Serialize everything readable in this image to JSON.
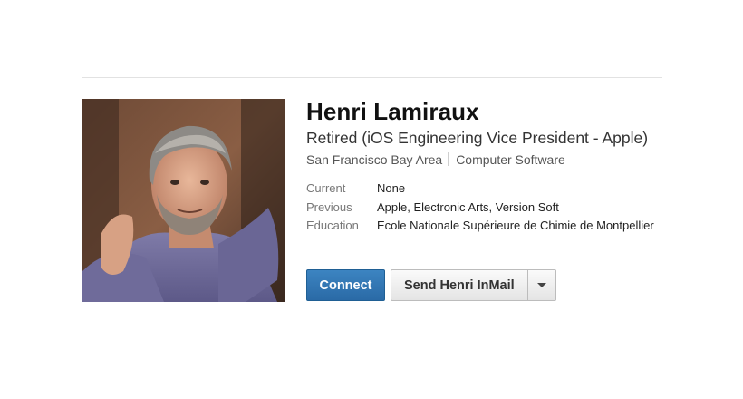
{
  "profile": {
    "name": "Henri Lamiraux",
    "headline": "Retired (iOS Engineering Vice President - Apple)",
    "location": "San Francisco Bay Area",
    "industry": "Computer Software",
    "details": [
      {
        "label": "Current",
        "value": "None"
      },
      {
        "label": "Previous",
        "value": "Apple, Electronic Arts, Version Soft"
      },
      {
        "label": "Education",
        "value": "Ecole Nationale Supérieure de Chimie de Montpellier"
      }
    ]
  },
  "actions": {
    "connect_label": "Connect",
    "inmail_label": "Send Henri InMail",
    "more_icon": "chevron-down-icon"
  },
  "colors": {
    "connect_button": "#2f73b0",
    "text_primary": "#111111",
    "text_secondary": "#777777"
  }
}
